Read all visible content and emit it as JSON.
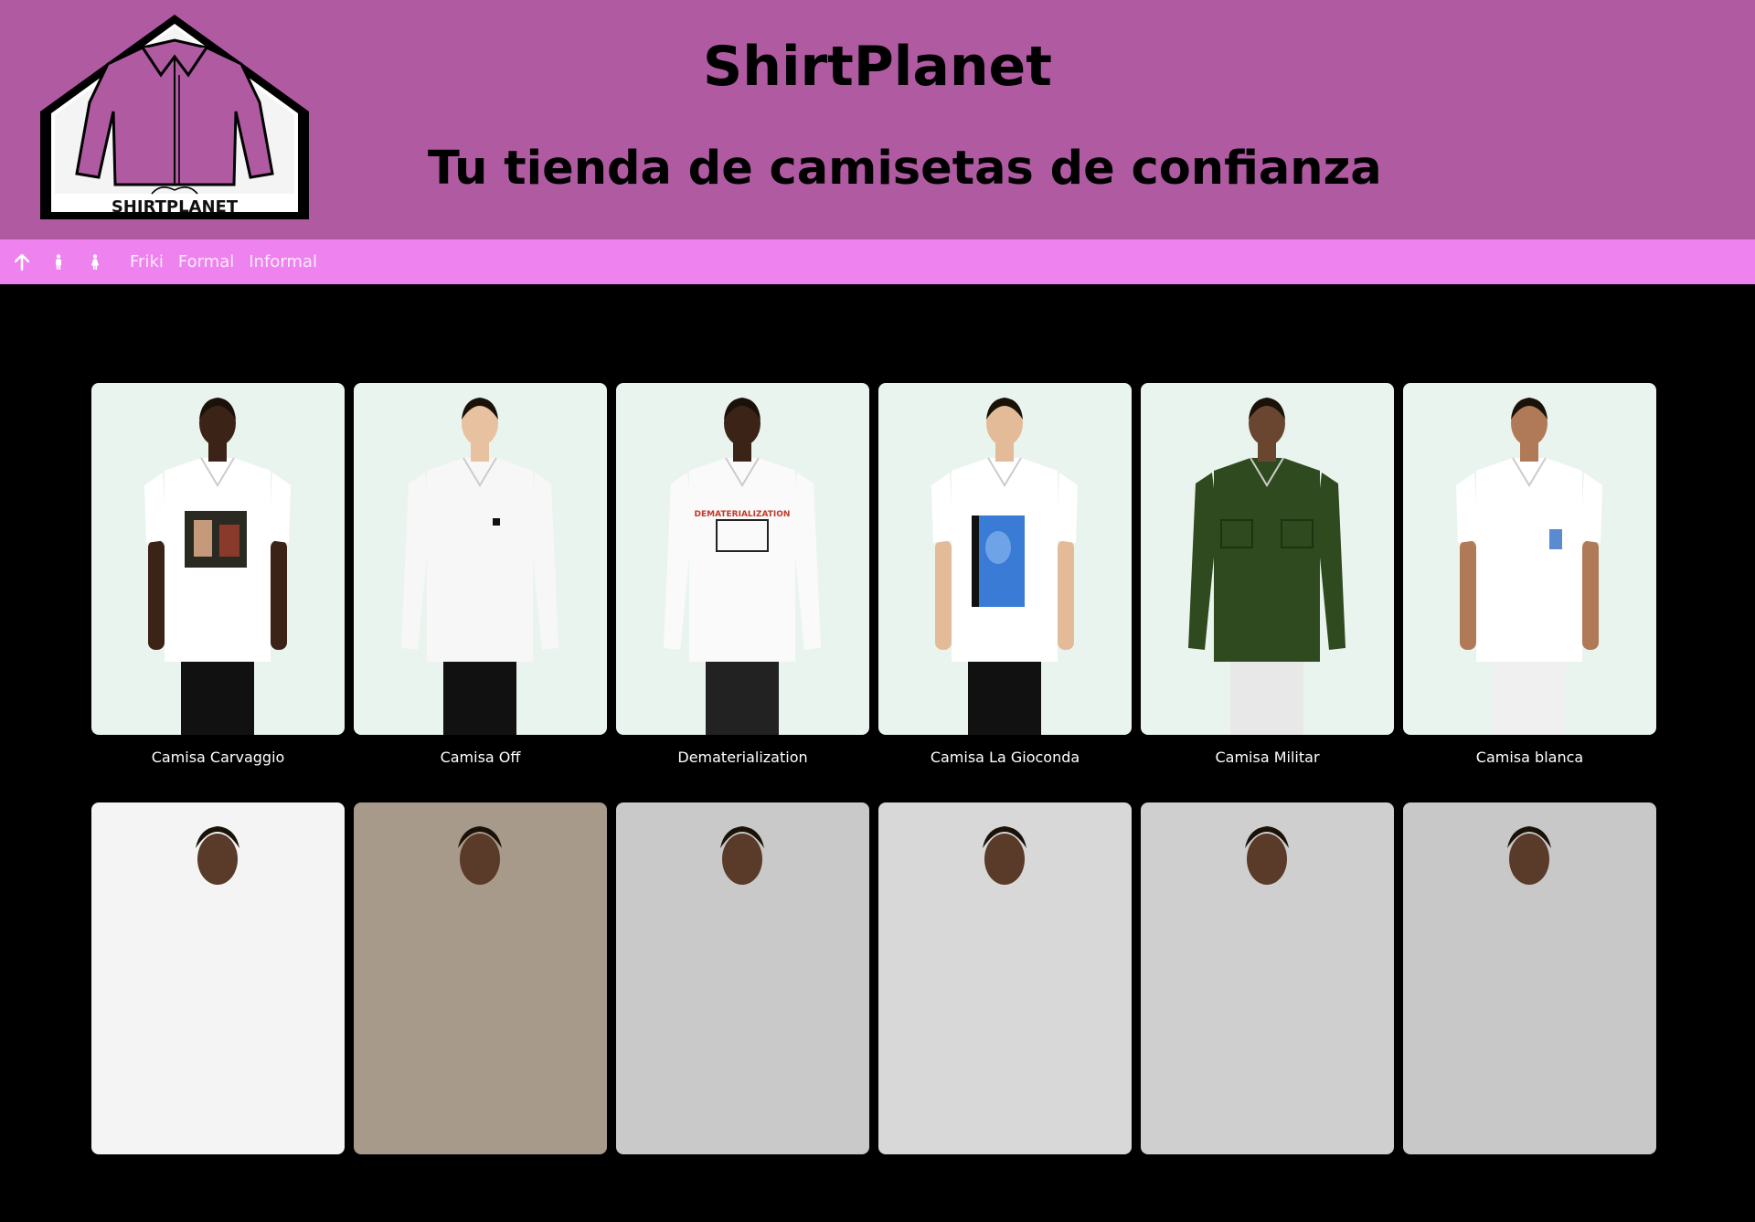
{
  "header": {
    "logo_text": "SHIRTPLANET",
    "title": "ShirtPlanet",
    "tagline": "Tu tienda de camisetas de confianza"
  },
  "nav": {
    "icons": [
      "arrow-up-icon",
      "man-icon",
      "woman-icon"
    ],
    "links": [
      "Friki",
      "Formal",
      "Informal"
    ]
  },
  "products_row1": [
    {
      "name": "Camisa Carvaggio",
      "shirt_color": "#ffffff",
      "print": "painting",
      "sleeves": "short",
      "pants": "#111111"
    },
    {
      "name": "Camisa Off",
      "shirt_color": "#f7f7f7",
      "print": "logo",
      "sleeves": "long",
      "pants": "#111111"
    },
    {
      "name": "Dematerialization",
      "shirt_color": "#fafafa",
      "print": "bulldozer",
      "sleeves": "long",
      "pants": "#222222"
    },
    {
      "name": "Camisa La Gioconda",
      "shirt_color": "#ffffff",
      "print": "mona-lisa",
      "sleeves": "short",
      "pants": "#111111"
    },
    {
      "name": "Camisa Militar",
      "shirt_color": "#2e4a1e",
      "print": "pockets",
      "sleeves": "long",
      "pants": "#e8e8e8"
    },
    {
      "name": "Camisa blanca",
      "shirt_color": "#ffffff",
      "print": "small-patch",
      "sleeves": "short",
      "pants": "#f0f0f0"
    }
  ],
  "products_row2": [
    {
      "bg": "#f4f4f4"
    },
    {
      "bg": "#a89a8a"
    },
    {
      "bg": "#c9c9c9"
    },
    {
      "bg": "#d8d8d8"
    },
    {
      "bg": "#cfcfcf"
    },
    {
      "bg": "#c8c8c8"
    }
  ],
  "colors": {
    "header_bg": "#b05aa2",
    "nav_bg": "#ee82ee",
    "page_bg": "#000000",
    "card_bg": "#eaf4ee"
  }
}
